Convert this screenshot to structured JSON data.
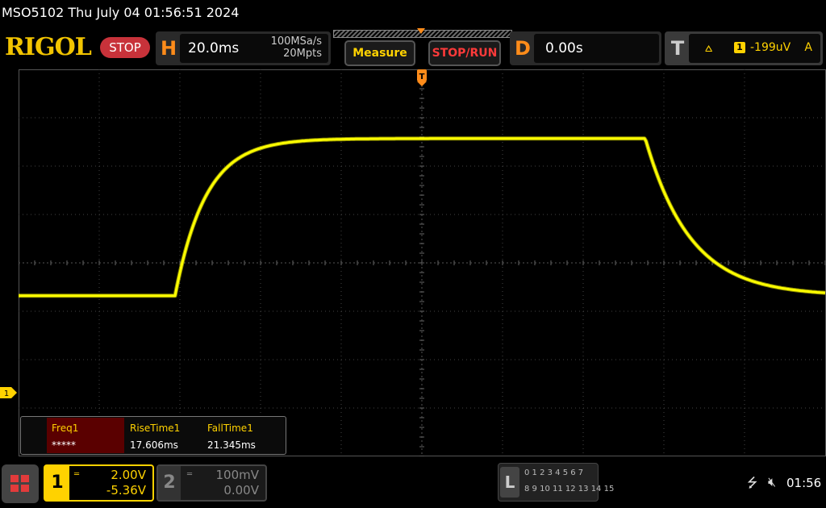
{
  "title_bar": {
    "text": "MSO5102  Thu July 04 01:56:51 2024"
  },
  "brand": {
    "logo": "RIGOL",
    "run_state": "STOP"
  },
  "horizontal": {
    "letter": "H",
    "timebase": "20.0ms",
    "sample_rate": "100MSa/s",
    "memory_depth": "20Mpts"
  },
  "toolbar": {
    "measure_label": "Measure",
    "stop_run_label": "STOP/RUN"
  },
  "delay": {
    "letter": "D",
    "value": "0.00s"
  },
  "trigger": {
    "letter": "T",
    "edge_icon": "rising-edge-icon",
    "source": "1",
    "level": "-199uV",
    "mode": "A"
  },
  "display": {
    "grid_divisions": {
      "horizontal": 10,
      "vertical": 8
    },
    "ch1_marker": "1",
    "trace_color": "#ffff00",
    "volts_per_div": 2.0,
    "offset_v": -5.36,
    "waveform": {
      "low_level_div": -0.68,
      "high_level_div": 2.57,
      "rise_start_time_div": -3.06,
      "rise_time_constant_div": 0.38,
      "fall_start_time_div": 2.77,
      "fall_time_constant_div": 0.56
    }
  },
  "measurements": [
    {
      "name": "Freq1",
      "value": "*****",
      "active": true
    },
    {
      "name": "RiseTime1",
      "value": "17.606ms",
      "active": false
    },
    {
      "name": "FallTime1",
      "value": "21.345ms",
      "active": false
    }
  ],
  "channels": {
    "ch1": {
      "number": "1",
      "coupling": "DC",
      "scale": "2.00V",
      "offset": "-5.36V"
    },
    "ch2": {
      "number": "2",
      "coupling": "DC",
      "scale": "100mV",
      "offset": "0.00V"
    }
  },
  "logic_analyzer": {
    "letter": "L",
    "row1": "0 1 2 3  4 5 6 7",
    "row2": "8 9 10 11 12 13 14 15"
  },
  "status": {
    "usb_icon": "usb-icon",
    "mute_icon": "speaker-mute-icon",
    "clock": "01:56"
  },
  "colors": {
    "ch1": "#ffd200",
    "brand": "#f2c400",
    "accent_orange": "#ff8c1a",
    "stop_red": "#c8323a",
    "grid": "#444444"
  }
}
